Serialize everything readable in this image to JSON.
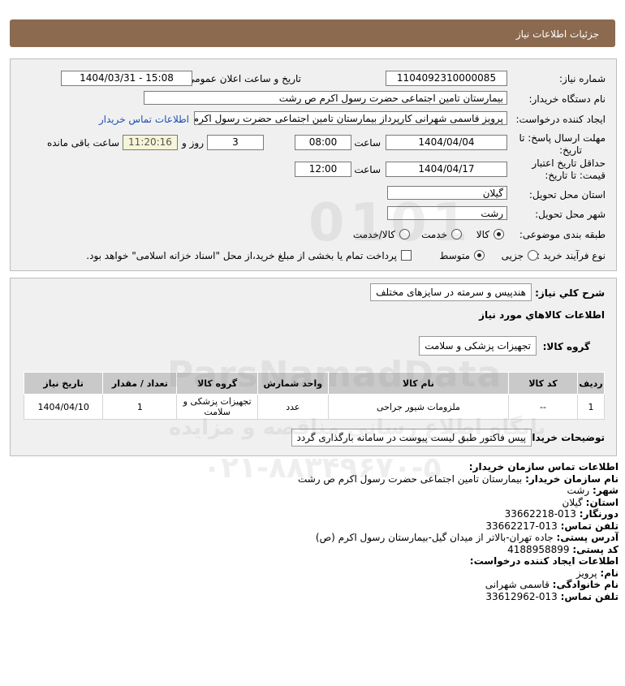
{
  "header": {
    "title": "جزئیات اطلاعات نیاز"
  },
  "fields": {
    "need_number_label": "شماره نیاز:",
    "need_number": "1104092310000085",
    "announce_label": "تاریخ و ساعت اعلان عمومی:",
    "announce_value": "1404/03/31 - 15:08",
    "buyer_label": "نام دستگاه خریدار:",
    "buyer_value": "بیمارستان  تامین اجتماعی حضرت رسول اکرم ص رشت",
    "creator_label": "ایجاد کننده درخواست:",
    "creator_value": "پرویز قاسمی شهرانی کارپرداز بیمارستان  تامین اجتماعی حضرت رسول اکرم ص",
    "contact_link": "اطلاعات تماس خریدار",
    "deadline_label_1": "مهلت ارسال پاسخ: تا",
    "deadline_label_2": "تاریخ:",
    "deadline_date": "1404/04/04",
    "time_label": "ساعت",
    "deadline_time": "08:00",
    "days_value": "3",
    "days_label": "روز و",
    "remaining_time": "11:20:16",
    "remaining_label": "ساعت باقی مانده",
    "validity_label_1": "حداقل تاریخ اعتبار",
    "validity_label_2": "قیمت: تا تاریخ:",
    "validity_date": "1404/04/17",
    "validity_time": "12:00",
    "province_label": "استان محل تحویل:",
    "province_value": "گیلان",
    "city_label": "شهر محل تحویل:",
    "city_value": "رشت",
    "category_label": "طبقه بندی موضوعی:",
    "category_options": [
      "کالا",
      "خدمت",
      "کالا/خدمت"
    ],
    "category_selected": "کالا",
    "process_label": "نوع فرآیند خرید :",
    "process_options": [
      "جزیی",
      "متوسط"
    ],
    "process_selected": "متوسط",
    "payment_note": "پرداخت تمام یا بخشی از مبلغ خرید،از محل \"اسناد خزانه اسلامی\" خواهد بود."
  },
  "summary": {
    "general_desc_label": "شرح كلي نياز:",
    "general_desc_value": "هندپیس و سرمته در سایزهای مختلف",
    "goods_info_title": "اطلاعات کالاهاي مورد نياز",
    "goods_group_label": "گروه کالا:",
    "goods_group_value": "تجهیزات پزشکی و سلامت",
    "table": {
      "headers": [
        "ردیف",
        "کد کالا",
        "نام کالا",
        "واحد شمارش",
        "گروه کالا",
        "تعداد / مقدار",
        "تاریخ نیاز"
      ],
      "rows": [
        [
          "1",
          "--",
          "ملزومات شیور جراحی",
          "عدد",
          "تجهیزات پزشکی و سلامت",
          "1",
          "1404/04/10"
        ]
      ]
    },
    "buyer_notes_label": "توضیحات خریدار:",
    "buyer_notes_value": "پیس فاکتور طبق لیست پیوست در سامانه بارگذاری گردد"
  },
  "contact": {
    "title": "اطلاعات تماس سازمان خریدار:",
    "org_label": "نام سازمان خریدار:",
    "org_value": "بیمارستان تامین اجتماعی حضرت رسول اکرم ص رشت",
    "city_label": "شهر:",
    "city_value": "رشت",
    "province_label": "استان:",
    "province_value": "گیلان",
    "fax_label": "دورنگار:",
    "fax_value": "013-33662218",
    "phone_label": "تلفن تماس:",
    "phone_value": "013-33662217",
    "address_label": "آدرس پستی:",
    "address_value": "جاده تهران-بالاتر از میدان گیل-بیمارستان رسول اکرم (ص)",
    "postal_label": "کد پستی:",
    "postal_value": "4188958899",
    "creator_title": "اطلاعات ایجاد کننده درخواست:",
    "first_name_label": "نام:",
    "first_name_value": "پرویز",
    "last_name_label": "نام خانوادگی:",
    "last_name_value": "قاسمی شهرانی",
    "creator_phone_label": "تلفن تماس:",
    "creator_phone_value": "013-33612962"
  },
  "watermark": {
    "brand": "ParsNamadData",
    "digits": "0101",
    "tagline": "پایگاه اطلاع رسانی مناقصه و مزایده",
    "phone": "۰۲۱-۸۸۳۴۹۶۷۰-۵"
  }
}
